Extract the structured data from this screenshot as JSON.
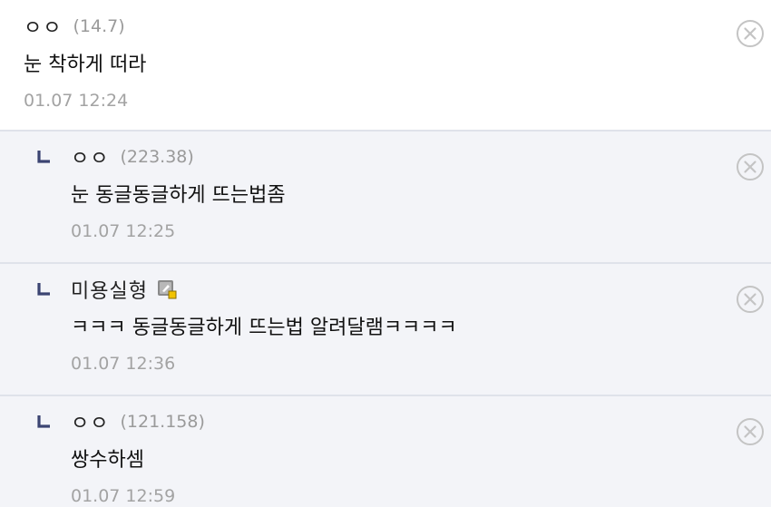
{
  "comments": [
    {
      "nickname": "ㅇㅇ",
      "ip": "(14.7)",
      "text": "눈 착하게 떠라",
      "time": "01.07 12:24",
      "is_reply": false
    },
    {
      "nickname": "ㅇㅇ",
      "ip": "(223.38)",
      "text": "눈 동글동글하게 뜨는법좀",
      "time": "01.07 12:25",
      "is_reply": true
    },
    {
      "nickname": "미용실형",
      "ip": "",
      "text": "ㅋㅋㅋ 동글동글하게 뜨는법 알려달램ㅋㅋㅋㅋ",
      "time": "01.07 12:36",
      "is_reply": true,
      "nick_icon": "fixed-nickname-icon"
    },
    {
      "nickname": "ㅇㅇ",
      "ip": "(121.158)",
      "text": "쌍수하셈",
      "time": "01.07 12:59",
      "is_reply": true
    }
  ],
  "icons": {
    "delete": "close-circle-icon",
    "reply": "reply-arrow-icon"
  },
  "colors": {
    "reply_mark": "#3b4472",
    "reply_bg": "#f3f4f8",
    "divider": "#dfe2ea",
    "meta_text": "#9a9a9a"
  }
}
